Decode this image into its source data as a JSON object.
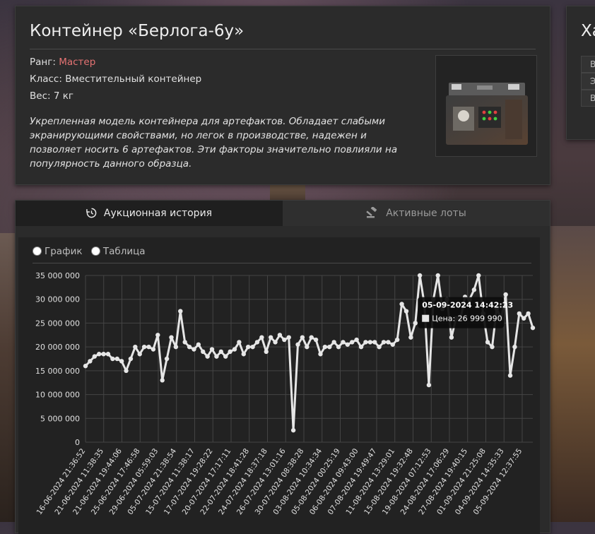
{
  "item": {
    "title": "Контейнер «Берлога-6у»",
    "rank_label": "Ранг:",
    "rank_value": "Мастер",
    "class_label": "Класс:",
    "class_value": "Вместительный контейнер",
    "weight_label": "Вес:",
    "weight_value": "7 кг",
    "description": "Укрепленная модель контейнера для артефактов. Обладает слабыми экранирующими свойствами, но легок в производстве, надежен и позволяет носить 6 артефактов. Эти факторы значительно повлияли на популярность данного образца."
  },
  "side_panel": {
    "title_partial": "Ха",
    "rows": [
      "В",
      "Э",
      "В"
    ]
  },
  "tabs": [
    {
      "label": "Аукционная история",
      "icon": "history-icon",
      "active": true
    },
    {
      "label": "Активные лоты",
      "icon": "gavel-icon",
      "active": false
    }
  ],
  "view_toggle": {
    "options": [
      "График",
      "Таблица"
    ]
  },
  "tooltip": {
    "date": "05-09-2024 14:42:23",
    "price_label": "Цена: 26 999 990"
  },
  "colors": {
    "line": "#e6e6e6",
    "grid": "#444444",
    "accent_rank": "#e57373"
  },
  "chart_data": {
    "type": "line",
    "ylim": [
      0,
      35000000
    ],
    "y_ticks": [
      "0",
      "5 000 000",
      "10 000 000",
      "15 000 000",
      "20 000 000",
      "25 000 000",
      "30 000 000",
      "35 000 000"
    ],
    "x_tick_labels": [
      "16-06-2024 21:36:52",
      "21-06-2024 11:38:35",
      "21-06-2024 19:44:06",
      "25-06-2024 17:46:58",
      "29-06-2024 05:59:03",
      "05-07-2024 21:38:54",
      "15-07-2024 11:38:17",
      "17-07-2024 19:28:22",
      "20-07-2024 17:17:11",
      "22-07-2024 18:41:28",
      "24-07-2024 18:37:18",
      "26-07-2024 13:01:16",
      "30-07-2024 08:38:28",
      "03-08-2024 10:34:34",
      "05-08-2024 00:25:19",
      "06-08-2024 09:43:00",
      "07-08-2024 19:49:47",
      "11-08-2024 13:29:01",
      "15-08-2024 19:32:48",
      "19-08-2024 07:12:53",
      "24-08-2024 17:06:29",
      "27-08-2024 19:40:15",
      "01-09-2024 21:25:08",
      "04-09-2024 14:35:33",
      "05-09-2024 12:37:55"
    ],
    "values": [
      16000000,
      17000000,
      18000000,
      18500000,
      18500000,
      18500000,
      17500000,
      17500000,
      17000000,
      15000000,
      17500000,
      20000000,
      18500000,
      20000000,
      20000000,
      19500000,
      22500000,
      13000000,
      17500000,
      22000000,
      20000000,
      27500000,
      21000000,
      20000000,
      19500000,
      20500000,
      19000000,
      18000000,
      19500000,
      18000000,
      19000000,
      18000000,
      19000000,
      19500000,
      21000000,
      18500000,
      20000000,
      20000000,
      21000000,
      22000000,
      19000000,
      22000000,
      21000000,
      22500000,
      21500000,
      22000000,
      2500000,
      20500000,
      22000000,
      20000000,
      22000000,
      21500000,
      18500000,
      20000000,
      20000000,
      21000000,
      20000000,
      21000000,
      20500000,
      21000000,
      21500000,
      20000000,
      21000000,
      21000000,
      21000000,
      20000000,
      21000000,
      21000000,
      20500000,
      21500000,
      29000000,
      27500000,
      22000000,
      25000000,
      35000000,
      29000000,
      12000000,
      30000000,
      35000000,
      28000000,
      30000000,
      22000000,
      26000000,
      26000000,
      30500000,
      30000000,
      32000000,
      35000000,
      27000000,
      21000000,
      20000000,
      28000000,
      26000000,
      31000000,
      14000000,
      20000000,
      27000000,
      26000000,
      27000000,
      24000000
    ],
    "hover_index": 97
  }
}
